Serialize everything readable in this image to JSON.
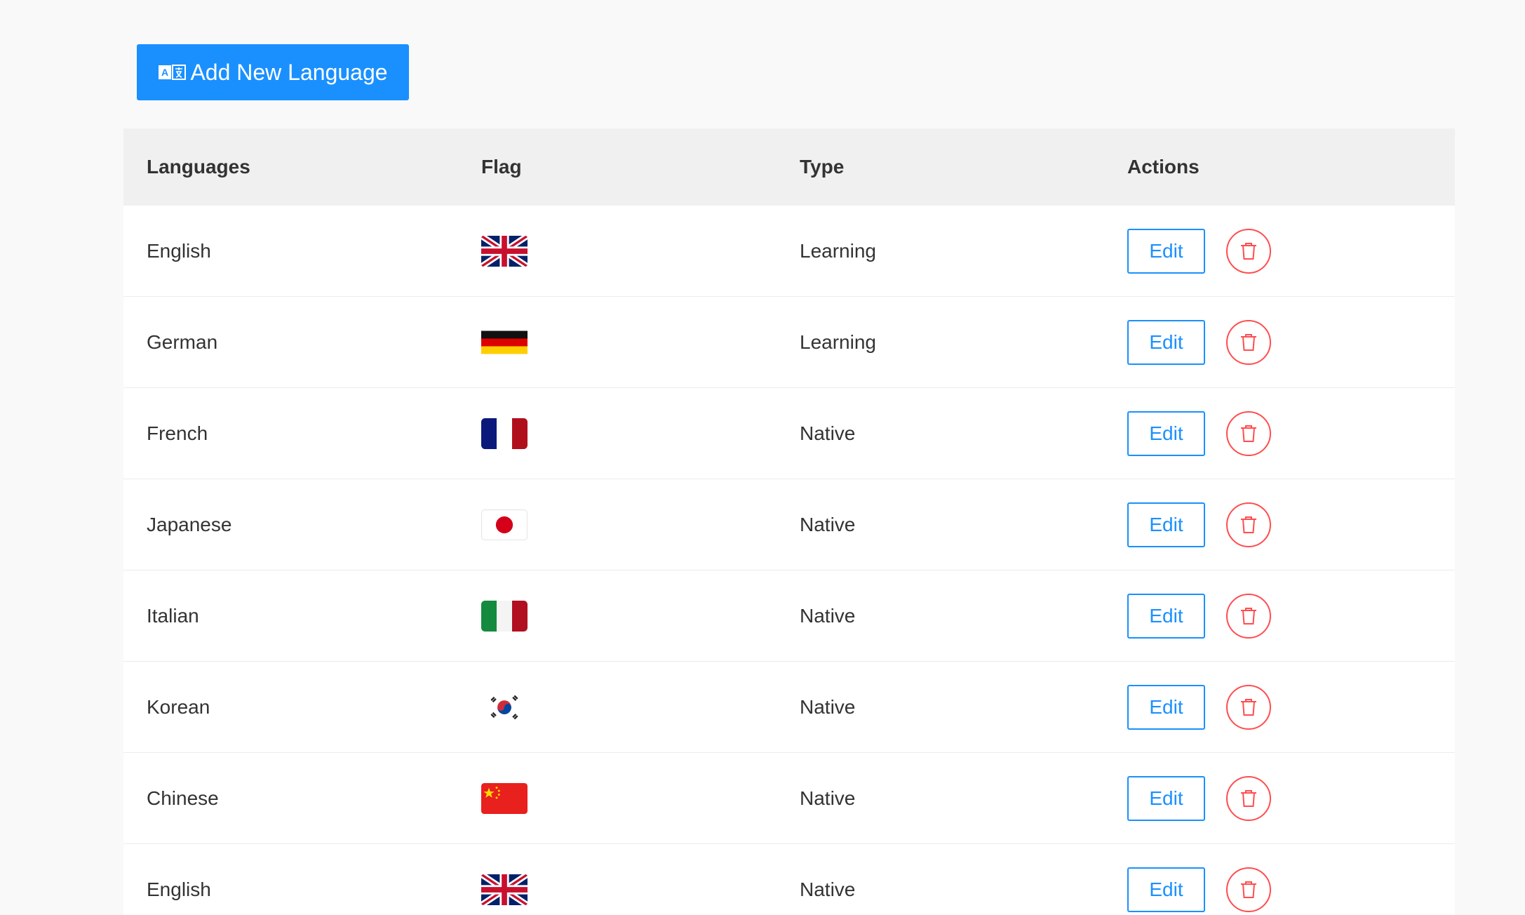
{
  "toolbar": {
    "add_label": "Add New Language"
  },
  "table": {
    "headers": {
      "languages": "Languages",
      "flag": "Flag",
      "type": "Type",
      "actions": "Actions"
    },
    "rows": [
      {
        "language": "English",
        "flag": "uk-flag-icon",
        "type": "Learning",
        "edit": "Edit"
      },
      {
        "language": "German",
        "flag": "germany-flag-icon",
        "type": "Learning",
        "edit": "Edit"
      },
      {
        "language": "French",
        "flag": "france-flag-icon",
        "type": "Native",
        "edit": "Edit"
      },
      {
        "language": "Japanese",
        "flag": "japan-flag-icon",
        "type": "Native",
        "edit": "Edit"
      },
      {
        "language": "Italian",
        "flag": "italy-flag-icon",
        "type": "Native",
        "edit": "Edit"
      },
      {
        "language": "Korean",
        "flag": "korea-flag-icon",
        "type": "Native",
        "edit": "Edit"
      },
      {
        "language": "Chinese",
        "flag": "china-flag-icon",
        "type": "Native",
        "edit": "Edit"
      },
      {
        "language": "English",
        "flag": "uk-flag-icon",
        "type": "Native",
        "edit": "Edit"
      }
    ]
  },
  "colors": {
    "primary": "#1a90ff",
    "danger": "#ff4d4f",
    "header_bg": "#f0f0f0",
    "page_bg": "#f9f9f9"
  }
}
